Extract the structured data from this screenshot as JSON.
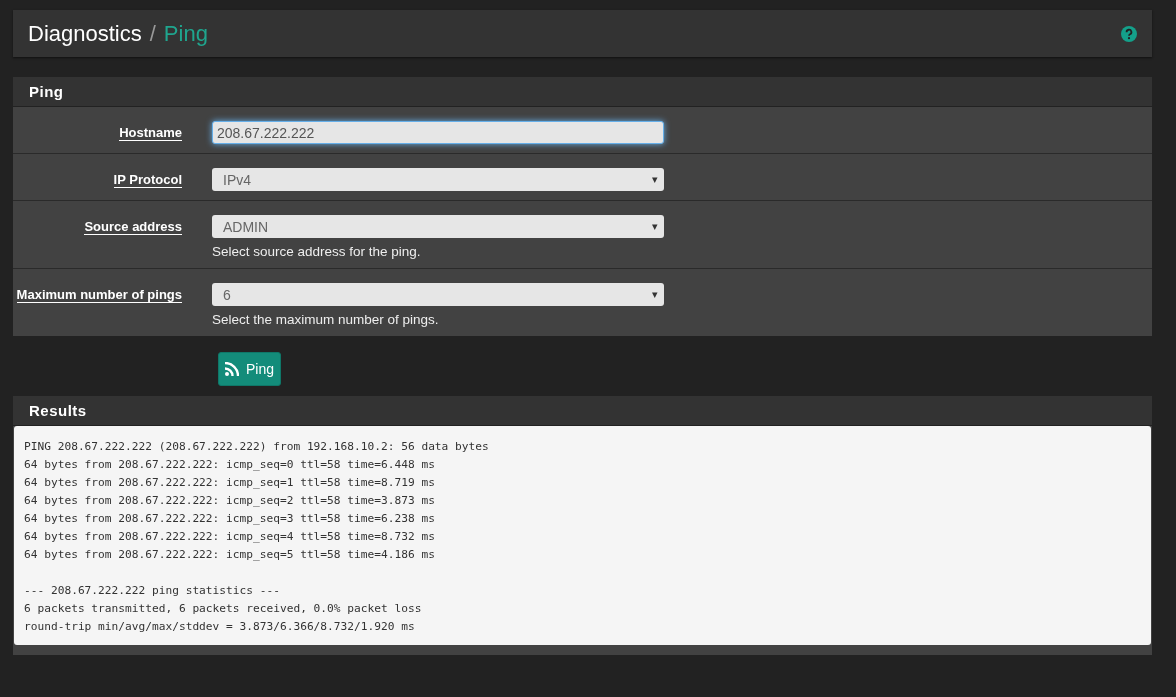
{
  "breadcrumb": {
    "section": "Diagnostics",
    "separator": "/",
    "page": "Ping"
  },
  "form_panel": {
    "title": "Ping",
    "fields": [
      {
        "label": "Hostname",
        "kind": "text",
        "value": "208.67.222.222",
        "focused": true
      },
      {
        "label": "IP Protocol",
        "kind": "select",
        "value": "IPv4",
        "caret": "▾"
      },
      {
        "label": "Source address",
        "kind": "select",
        "value": "ADMIN",
        "caret": "▾",
        "help": "Select source address for the ping."
      },
      {
        "label": "Maximum number of pings",
        "kind": "select",
        "value": "6",
        "caret": "▾",
        "help": "Select the maximum number of pings."
      }
    ]
  },
  "ping_button": {
    "label": "Ping"
  },
  "results_panel": {
    "title": "Results",
    "output_blocks": [
      [
        "PING 208.67.222.222 (208.67.222.222) from 192.168.10.2: 56 data bytes",
        "64 bytes from 208.67.222.222: icmp_seq=0 ttl=58 time=6.448 ms",
        "64 bytes from 208.67.222.222: icmp_seq=1 ttl=58 time=8.719 ms",
        "64 bytes from 208.67.222.222: icmp_seq=2 ttl=58 time=3.873 ms",
        "64 bytes from 208.67.222.222: icmp_seq=3 ttl=58 time=6.238 ms",
        "64 bytes from 208.67.222.222: icmp_seq=4 ttl=58 time=8.732 ms",
        "64 bytes from 208.67.222.222: icmp_seq=5 ttl=58 time=4.186 ms"
      ],
      [
        "--- 208.67.222.222 ping statistics ---",
        "6 packets transmitted, 6 packets received, 0.0% packet loss",
        "round-trip min/avg/max/stddev = 3.873/6.366/8.732/1.920 ms"
      ]
    ]
  }
}
